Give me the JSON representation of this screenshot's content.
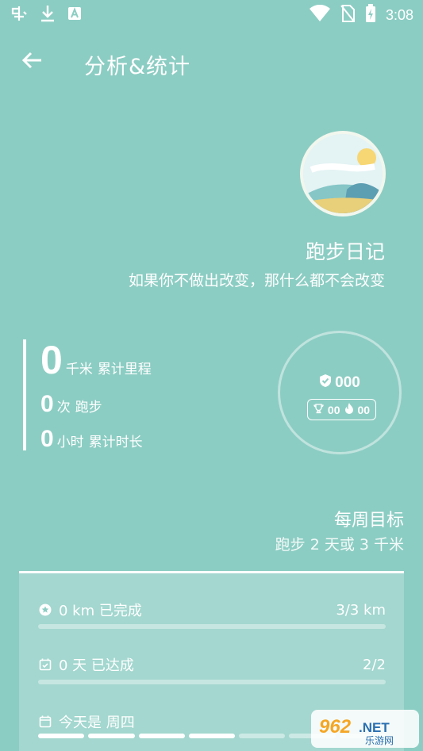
{
  "status_bar": {
    "time": "3:08",
    "icons": [
      "app-notification-icon",
      "download-icon",
      "a-badge-icon",
      "wifi-icon",
      "no-sim-icon",
      "battery-charging-icon"
    ]
  },
  "header": {
    "title": "分析&统计",
    "back_icon": "arrow-left-icon"
  },
  "profile": {
    "name": "跑步日记",
    "motto": "如果你不做出改变，那什么都不会改变"
  },
  "stats": {
    "distance": {
      "value": "0",
      "unit": "千米",
      "label": "累计里程"
    },
    "runs": {
      "value": "0",
      "unit": "次",
      "label": "跑步"
    },
    "duration": {
      "value": "0",
      "unit": "小时",
      "label": "累计时长"
    }
  },
  "badge_ring": {
    "points": "000",
    "trophies": "00",
    "flames": "00"
  },
  "weekly_goal": {
    "title": "每周目标",
    "description": "跑步 2 天或 3 千米",
    "distance_label": "0 km 已完成",
    "distance_value": "3/3 km",
    "distance_progress": 0,
    "days_label": "0 天 已达成",
    "days_value": "2/2",
    "days_progress": 0,
    "today_label": "今天是 周四",
    "week_days": 7,
    "current_day_index": 3
  },
  "watermark": {
    "text": "962.NET",
    "sub": "乐游网"
  },
  "colors": {
    "background": "#8ccdc3",
    "text": "#ffffff"
  }
}
